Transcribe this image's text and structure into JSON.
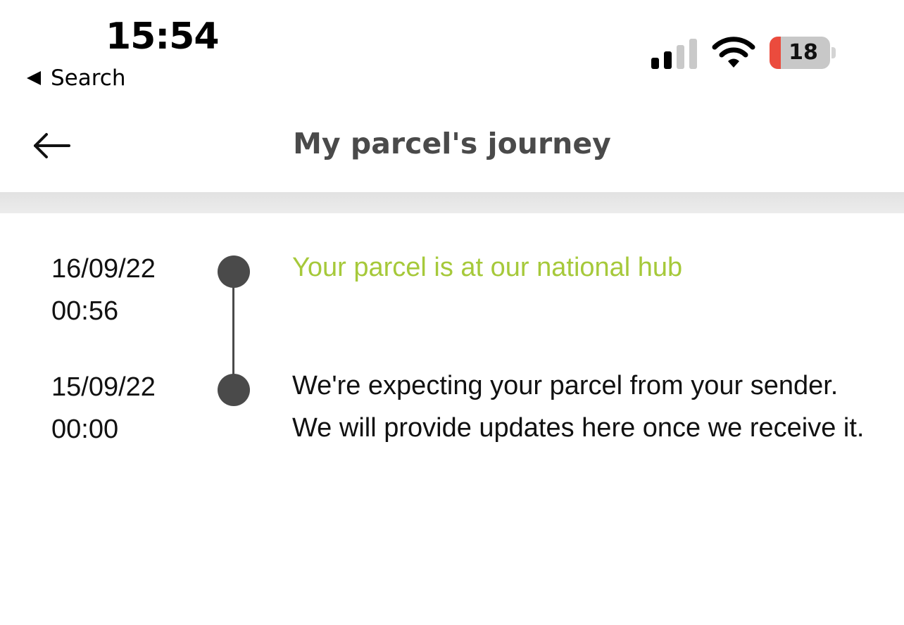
{
  "status_bar": {
    "time": "15:54",
    "back_to_app_label": "Search",
    "battery_percent": "18",
    "signal_icon": "cellular-signal-icon",
    "wifi_icon": "wifi-icon",
    "battery_icon": "battery-icon",
    "signal_bars_active": 2,
    "signal_bars_total": 4
  },
  "header": {
    "back_icon": "arrow-left-icon",
    "title": "My parcel's journey"
  },
  "colors": {
    "accent_green": "#a6c93a",
    "timeline_gray": "#4a4a4a",
    "title_gray": "#4a4a4a",
    "battery_low_red": "#eb4b3d"
  },
  "timeline": {
    "events": [
      {
        "date": "16/09/22",
        "time": "00:56",
        "description": "Your parcel is at our national hub",
        "status": "current"
      },
      {
        "date": "15/09/22",
        "time": "00:00",
        "description": "We're expecting your parcel from your sender. We will provide updates here once we receive it.",
        "status": "past"
      }
    ]
  }
}
